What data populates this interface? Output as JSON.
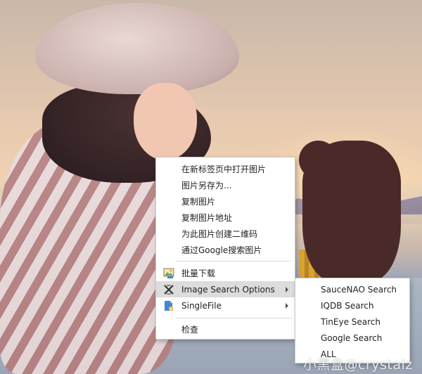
{
  "context_menu": {
    "items": [
      {
        "label": "在新标签页中打开图片"
      },
      {
        "label": "图片另存为..."
      },
      {
        "label": "复制图片"
      },
      {
        "label": "复制图片地址"
      },
      {
        "label": "为此图片创建二维码"
      },
      {
        "label": "通过Google搜索图片"
      },
      {
        "label": "批量下载",
        "icon": "image-download-icon"
      },
      {
        "label": "Image Search Options",
        "icon": "x-search-icon",
        "has_submenu": true,
        "highlighted": true
      },
      {
        "label": "SingleFile",
        "icon": "singlefile-icon",
        "has_submenu": true
      },
      {
        "label": "检查"
      }
    ]
  },
  "submenu": {
    "items": [
      {
        "label": "SauceNAO Search"
      },
      {
        "label": "IQDB Search"
      },
      {
        "label": "TinEye Search"
      },
      {
        "label": "Google Search"
      },
      {
        "label": "ALL"
      }
    ]
  },
  "watermark": {
    "text": "小黑盒@crystalz"
  },
  "colors": {
    "menu_bg": "#ffffff",
    "menu_hover": "#dcdcdc",
    "menu_border": "#c9c9c9",
    "text": "#222222"
  }
}
